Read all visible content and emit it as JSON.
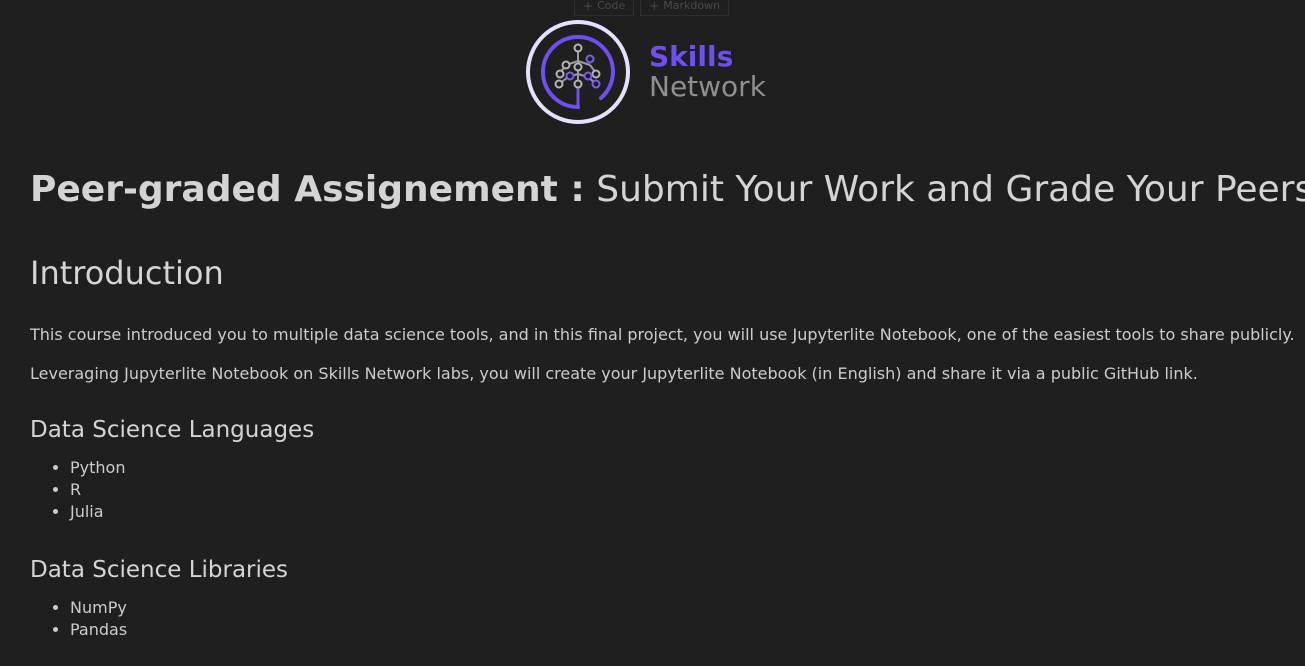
{
  "toolbar": {
    "code_label": "Code",
    "markdown_label": "Markdown"
  },
  "logo": {
    "word1": "Skills",
    "word2": "Network",
    "accent_color": "#6f4ef2",
    "ring_color": "#e6e0ff"
  },
  "notebook": {
    "title_bold": "Peer-graded Assignement :",
    "title_rest": " Submit Your Work and Grade Your Peers",
    "intro_heading": "Introduction",
    "intro_paragraph_1": "This course introduced you to multiple data science tools, and in this final project, you will use Jupyterlite Notebook, one of the easiest tools to share publicly.",
    "intro_paragraph_2": "Leveraging Jupyterlite Notebook on Skills Network labs, you will create your Jupyterlite Notebook (in English) and share it via a public GitHub link.",
    "languages_heading": "Data Science Languages",
    "languages": [
      "Python",
      "R",
      "Julia"
    ],
    "libraries_heading": "Data Science Libraries",
    "libraries": [
      "NumPy",
      "Pandas"
    ]
  }
}
